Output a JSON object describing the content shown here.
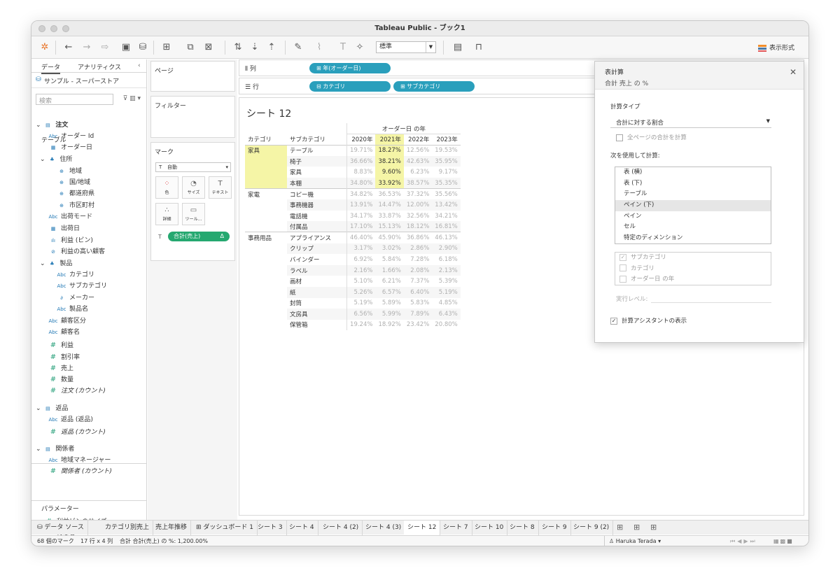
{
  "window": {
    "title": "Tableau Public - ブック1"
  },
  "toolbar": {
    "format_select": "標準",
    "show_me": "表示形式"
  },
  "left": {
    "tabs": [
      "データ",
      "アナリティクス"
    ],
    "source": "サンプル - スーパーストア",
    "search_placeholder": "検索",
    "tables_label": "テーブル",
    "parameters_label": "パラメーター",
    "items": [
      {
        "label": "注文",
        "icon": "table-icon",
        "bold": true
      },
      {
        "label": "オーダー Id",
        "icon": "Abc"
      },
      {
        "label": "オーダー日",
        "icon": "calendar-icon"
      },
      {
        "label": "住所",
        "icon": "hierarchy-icon"
      },
      {
        "label": "地域",
        "icon": "globe-icon"
      },
      {
        "label": "国/地域",
        "icon": "globe-icon"
      },
      {
        "label": "都道府県",
        "icon": "globe-icon"
      },
      {
        "label": "市区町村",
        "icon": "globe-icon"
      },
      {
        "label": "出荷モード",
        "icon": "Abc"
      },
      {
        "label": "出荷日",
        "icon": "calendar-icon"
      },
      {
        "label": "利益 (ビン)",
        "icon": "bin-icon"
      },
      {
        "label": "利益の高い顧客",
        "icon": "set-icon"
      },
      {
        "label": "製品",
        "icon": "hierarchy-icon"
      },
      {
        "label": "カテゴリ",
        "icon": "Abc"
      },
      {
        "label": "サブカテゴリ",
        "icon": "Abc"
      },
      {
        "label": "メーカー",
        "icon": "paperclip-icon"
      },
      {
        "label": "製品名",
        "icon": "Abc"
      },
      {
        "label": "顧客区分",
        "icon": "Abc"
      },
      {
        "label": "顧客名",
        "icon": "Abc"
      },
      {
        "label": "利益",
        "icon": "#"
      },
      {
        "label": "割引率",
        "icon": "#"
      },
      {
        "label": "売上",
        "icon": "#"
      },
      {
        "label": "数量",
        "icon": "#"
      },
      {
        "label": "注文 (カウント)",
        "icon": "#"
      },
      {
        "label": "返品",
        "icon": "table-icon"
      },
      {
        "label": "返品 (返品)",
        "icon": "Abc"
      },
      {
        "label": "返品 (カウント)",
        "icon": "#"
      },
      {
        "label": "関係者",
        "icon": "table-icon"
      },
      {
        "label": "地域マネージャー",
        "icon": "Abc"
      },
      {
        "label": "関係者 (カウント)",
        "icon": "#"
      }
    ],
    "parameters": [
      "利益ビンのサイズ",
      "得意客"
    ]
  },
  "cards": {
    "pages": "ページ",
    "filters": "フィルター",
    "marks": "マーク",
    "mark_type": "自動",
    "buttons": [
      "色",
      "サイズ",
      "テキスト",
      "詳細",
      "ツール..."
    ],
    "measure_pill": "合計(売上)",
    "delta": "Δ"
  },
  "shelves": {
    "columns_label": "列",
    "rows_label": "行",
    "columns_pills": [
      "年(オーダー日)"
    ],
    "rows_pills": [
      "カテゴリ",
      "サブカテゴリ"
    ]
  },
  "sheet": {
    "title": "シート 12",
    "col_group_header": "オーダー日 の年",
    "headers": [
      "カテゴリ",
      "サブカテゴリ",
      "2020年",
      "2021年",
      "2022年",
      "2023年"
    ],
    "groups": [
      {
        "category": "家具",
        "rows": [
          [
            "テーブル",
            "19.71%",
            "18.27%",
            "12.56%",
            "19.53%"
          ],
          [
            "椅子",
            "36.66%",
            "38.21%",
            "42.63%",
            "35.95%"
          ],
          [
            "家具",
            "8.83%",
            "9.60%",
            "6.23%",
            "9.17%"
          ],
          [
            "本棚",
            "34.80%",
            "33.92%",
            "38.57%",
            "35.35%"
          ]
        ]
      },
      {
        "category": "家電",
        "rows": [
          [
            "コピー機",
            "34.82%",
            "36.53%",
            "37.32%",
            "35.56%"
          ],
          [
            "事務機器",
            "13.91%",
            "14.47%",
            "12.00%",
            "13.42%"
          ],
          [
            "電話機",
            "34.17%",
            "33.87%",
            "32.56%",
            "34.21%"
          ],
          [
            "付属品",
            "17.10%",
            "15.13%",
            "18.12%",
            "16.81%"
          ]
        ]
      },
      {
        "category": "事務用品",
        "rows": [
          [
            "アプライアンス",
            "46.40%",
            "45.90%",
            "36.86%",
            "46.13%"
          ],
          [
            "クリップ",
            "3.17%",
            "3.02%",
            "2.86%",
            "2.90%"
          ],
          [
            "バインダー",
            "6.92%",
            "5.84%",
            "7.28%",
            "6.18%"
          ],
          [
            "ラベル",
            "2.16%",
            "1.66%",
            "2.08%",
            "2.13%"
          ],
          [
            "画材",
            "5.10%",
            "6.21%",
            "7.37%",
            "5.39%"
          ],
          [
            "紙",
            "5.26%",
            "6.57%",
            "6.40%",
            "5.19%"
          ],
          [
            "封筒",
            "5.19%",
            "5.89%",
            "5.83%",
            "4.85%"
          ],
          [
            "文房具",
            "6.56%",
            "5.99%",
            "7.89%",
            "6.43%"
          ],
          [
            "保管箱",
            "19.24%",
            "18.92%",
            "23.42%",
            "20.80%"
          ]
        ]
      }
    ]
  },
  "dialog": {
    "title": "表計算",
    "subtitle": "合計 売上 の %",
    "calc_type_label": "計算タイプ",
    "calc_type_value": "合計に対する割合",
    "all_pages_label": "全ページの合計を計算",
    "compute_using_label": "次を使用して計算:",
    "compute_options": [
      "表 (横)",
      "表 (下)",
      "テーブル",
      "ペイン (下)",
      "ペイン",
      "セル",
      "特定のディメンション"
    ],
    "selected_option_index": 3,
    "dimensions": [
      "サブカテゴリ",
      "カテゴリ",
      "オーダー日 の年"
    ],
    "level_label": "実行レベル:",
    "assistant_label": "計算アシスタントの表示"
  },
  "tabs": [
    "データ ソース",
    "カテゴリ別売上",
    "売上年推移",
    "ダッシュボード 1",
    "シート 3",
    "シート 4",
    "シート 4 (2)",
    "シート 4 (3)",
    "シート 12",
    "シート 7",
    "シート 10",
    "シート 8",
    "シート 9",
    "シート 9 (2)"
  ],
  "active_tab_index": 8,
  "status": {
    "marks": "68 個のマーク",
    "dims": "17 行 x 4 列",
    "sum": "合計 合計(売上) の %: 1,200.00%",
    "user": "Haruka Terada"
  }
}
